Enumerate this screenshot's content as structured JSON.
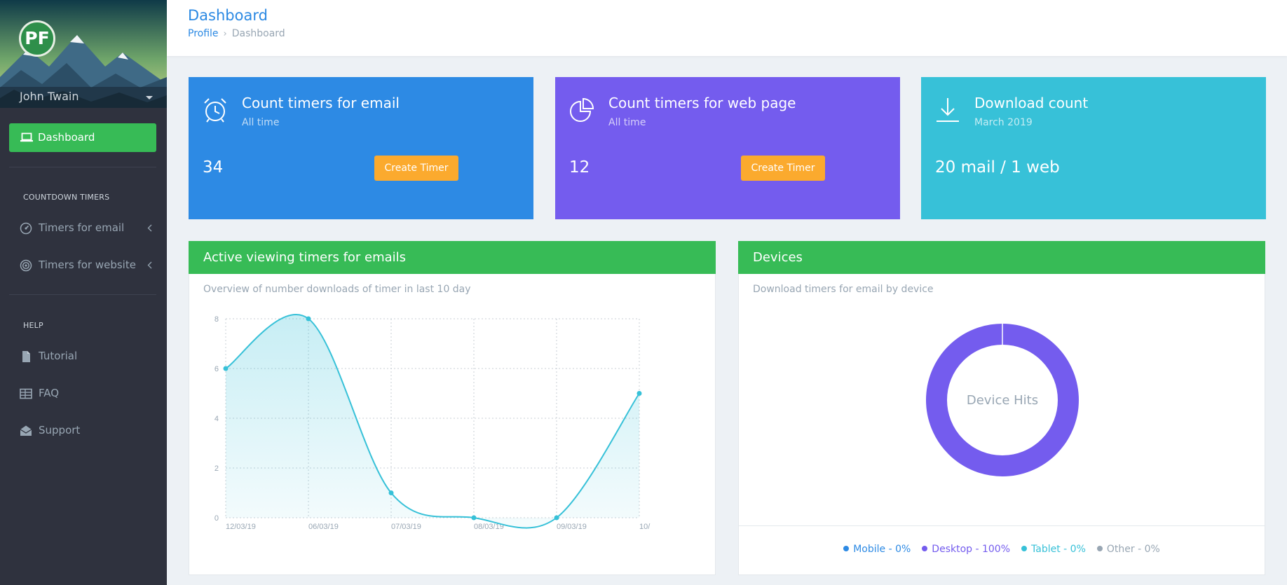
{
  "sidebar": {
    "logo_text": "PF",
    "user_name": "John Twain",
    "dashboard_label": "Dashboard",
    "section_countdown": "COUNTDOWN TIMERS",
    "timers_email": "Timers for email",
    "timers_website": "Timers for website",
    "section_help": "HELP",
    "tutorial": "Tutorial",
    "faq": "FAQ",
    "support": "Support"
  },
  "header": {
    "title": "Dashboard",
    "breadcrumb": [
      "Profile",
      "Dashboard"
    ]
  },
  "cards": [
    {
      "title": "Count timers for email",
      "subtitle": "All time",
      "value": "34",
      "button": "Create Timer",
      "color": "#2d8ae4",
      "icon": "alarm-clock-icon"
    },
    {
      "title": "Count timers for web page",
      "subtitle": "All time",
      "value": "12",
      "button": "Create Timer",
      "color": "#745cee",
      "icon": "pie-chart-icon"
    },
    {
      "title": "Download count",
      "subtitle": "March 2019",
      "value": "20 mail / 1 web",
      "color": "#37c1d8",
      "icon": "download-icon"
    }
  ],
  "panels": {
    "activity": {
      "title": "Active viewing timers for emails",
      "subtitle": "Overview of number downloads of timer in last 10 day"
    },
    "devices": {
      "title": "Devices",
      "subtitle": "Download timers for email by device",
      "center_label": "Device Hits",
      "legend": [
        {
          "label": "Mobile - 0%",
          "color": "#2d8ae4"
        },
        {
          "label": "Desktop - 100%",
          "color": "#745cee"
        },
        {
          "label": "Tablet - 0%",
          "color": "#37c1d8"
        },
        {
          "label": "Other - 0%",
          "color": "#98a6b3"
        }
      ]
    }
  },
  "chart_data": [
    {
      "type": "area",
      "categories": [
        "12/03/19",
        "06/03/19",
        "07/03/19",
        "08/03/19",
        "09/03/19",
        "10/"
      ],
      "values": [
        6,
        8,
        1,
        0,
        0,
        5
      ],
      "ylim": [
        0,
        8
      ],
      "yticks": [
        "0",
        "2",
        "4",
        "6",
        "8"
      ],
      "grid": true,
      "color": "#37c1d8"
    },
    {
      "type": "pie",
      "labels": [
        "Mobile",
        "Desktop",
        "Tablet",
        "Other"
      ],
      "values": [
        0,
        100,
        0,
        0
      ]
    }
  ]
}
